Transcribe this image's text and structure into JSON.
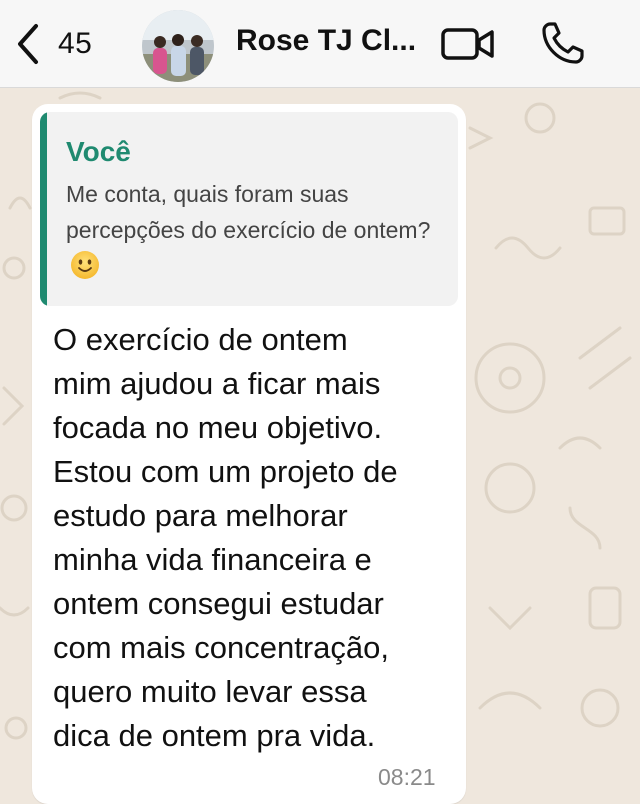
{
  "header": {
    "back_count": "45",
    "contact_name": "Rose TJ Cl...",
    "back_icon": "chevron-left-icon",
    "video_icon": "video-camera-icon",
    "call_icon": "phone-icon"
  },
  "message": {
    "quote": {
      "author": "Você",
      "text": "Me conta, quais foram suas percepções do exercício de ontem?",
      "emoji": "slightly-smiling-face"
    },
    "lines": [
      "O exercício de ontem",
      "mim ajudou a ficar mais",
      "focada no meu objetivo.",
      "Estou com um projeto de",
      "estudo para melhorar",
      "minha vida financeira e",
      "ontem consegui estudar",
      "com mais concentração,",
      "quero muito levar essa",
      "dica de ontem pra vida."
    ],
    "time": "08:21"
  },
  "colors": {
    "accent": "#1f8a70",
    "chat_background": "#efe7dd",
    "header_background": "#f7f7f7",
    "bubble": "#ffffff",
    "quote_background": "#f2f2f2"
  }
}
